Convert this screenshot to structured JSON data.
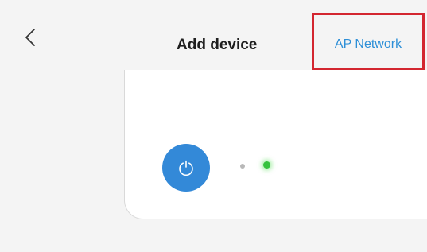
{
  "header": {
    "back_icon": "chevron-left-icon",
    "title": "Add device",
    "ap_network_label": "AP Network"
  },
  "device_card": {
    "power_icon": "power-icon",
    "indicator_dots": [
      "grey",
      "green"
    ]
  },
  "colors": {
    "accent_blue": "#2d8fd7",
    "power_button_blue": "#3389d8",
    "highlight_red": "#d32630",
    "indicator_green": "#36c23e",
    "indicator_grey": "#b8b8b8",
    "background": "#f4f4f4",
    "card_background": "#ffffff"
  }
}
